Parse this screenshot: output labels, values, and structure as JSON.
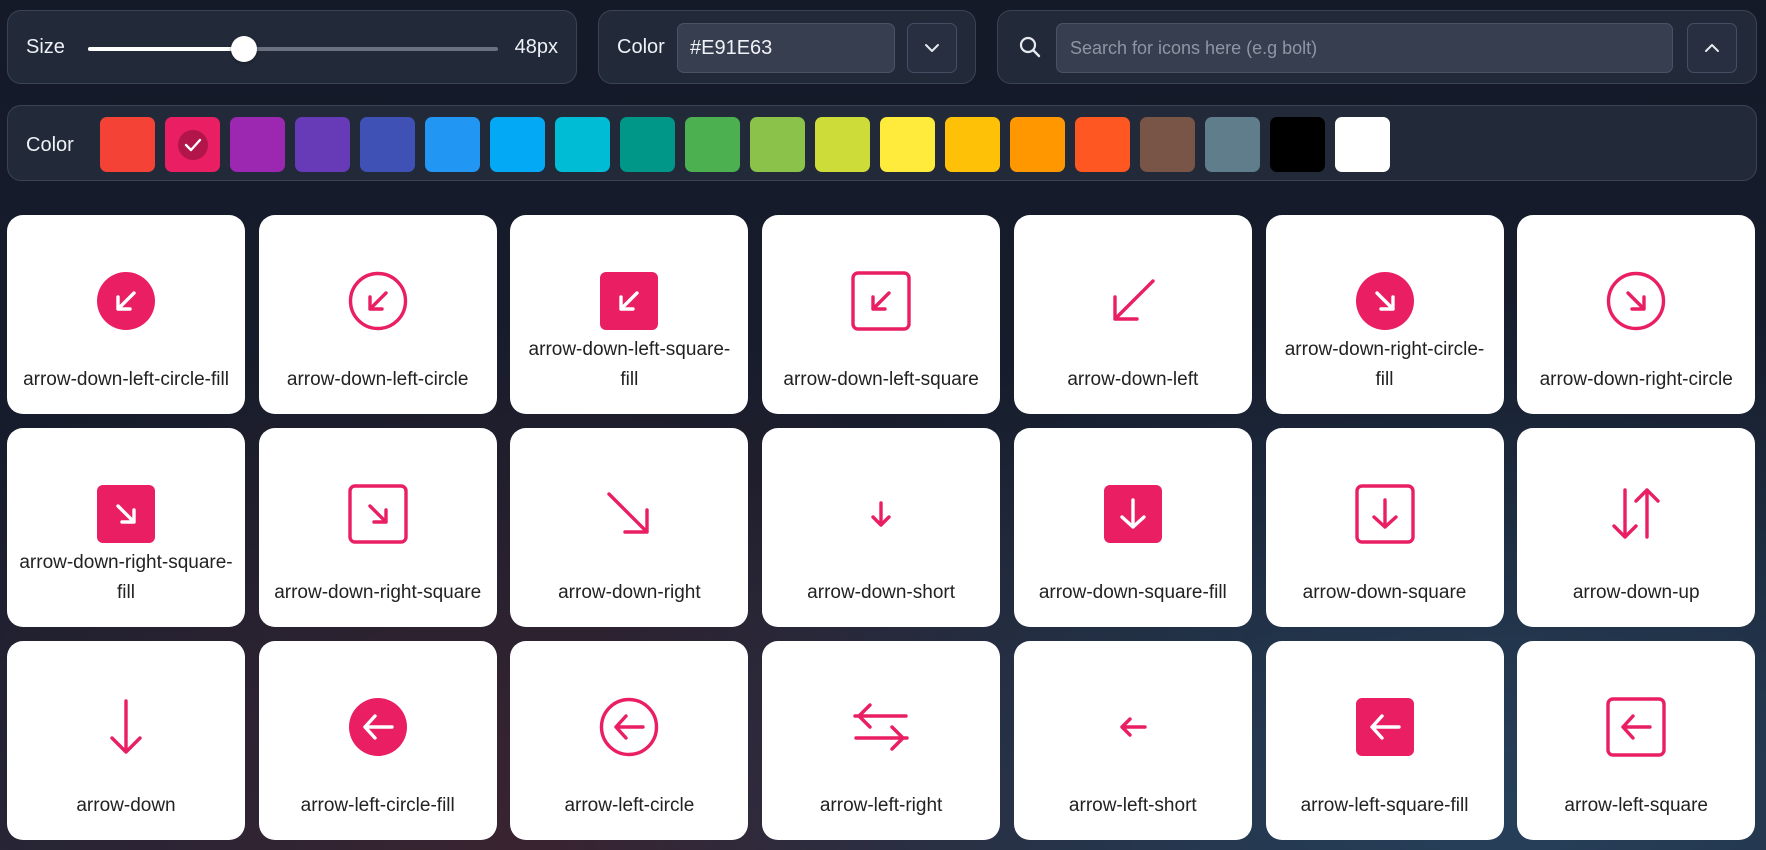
{
  "size_control": {
    "label": "Size",
    "value_text": "48px",
    "fraction": 0.38
  },
  "color_control": {
    "label": "Color",
    "value": "#E91E63",
    "dropdown_icon": "chevron-down-icon"
  },
  "search": {
    "placeholder": "Search for icons here (e.g bolt)",
    "icon": "search-icon",
    "collapse_icon": "chevron-up-icon"
  },
  "palette": {
    "label": "Color",
    "selected_index": 1,
    "swatches": [
      "#F44336",
      "#E91E63",
      "#9C27B0",
      "#673AB7",
      "#3F51B5",
      "#2196F3",
      "#03A9F4",
      "#00BCD4",
      "#009688",
      "#4CAF50",
      "#8BC34A",
      "#CDDC39",
      "#FFEB3B",
      "#FFC107",
      "#FF9800",
      "#FF5722",
      "#795548",
      "#607D8B",
      "#000000",
      "#FFFFFF"
    ]
  },
  "accent": "#E91E63",
  "icons": [
    {
      "name": "arrow-down-left-circle-fill",
      "label": [
        "arrow-down-left-circle-fill"
      ]
    },
    {
      "name": "arrow-down-left-circle",
      "label": [
        "arrow-down-left-circle"
      ]
    },
    {
      "name": "arrow-down-left-square-fill",
      "label": [
        "arrow-down-left-square-",
        "fill"
      ]
    },
    {
      "name": "arrow-down-left-square",
      "label": [
        "arrow-down-left-square"
      ]
    },
    {
      "name": "arrow-down-left",
      "label": [
        "arrow-down-left"
      ]
    },
    {
      "name": "arrow-down-right-circle-fill",
      "label": [
        "arrow-down-right-circle-",
        "fill"
      ]
    },
    {
      "name": "arrow-down-right-circle",
      "label": [
        "arrow-down-right-circle"
      ]
    },
    {
      "name": "arrow-down-right-square-fill",
      "label": [
        "arrow-down-right-square-",
        "fill"
      ]
    },
    {
      "name": "arrow-down-right-square",
      "label": [
        "arrow-down-right-square"
      ]
    },
    {
      "name": "arrow-down-right",
      "label": [
        "arrow-down-right"
      ]
    },
    {
      "name": "arrow-down-short",
      "label": [
        "arrow-down-short"
      ]
    },
    {
      "name": "arrow-down-square-fill",
      "label": [
        "arrow-down-square-fill"
      ]
    },
    {
      "name": "arrow-down-square",
      "label": [
        "arrow-down-square"
      ]
    },
    {
      "name": "arrow-down-up",
      "label": [
        "arrow-down-up"
      ]
    },
    {
      "name": "arrow-down",
      "label": [
        "arrow-down"
      ]
    },
    {
      "name": "arrow-left-circle-fill",
      "label": [
        "arrow-left-circle-fill"
      ]
    },
    {
      "name": "arrow-left-circle",
      "label": [
        "arrow-left-circle"
      ]
    },
    {
      "name": "arrow-left-right",
      "label": [
        "arrow-left-right"
      ]
    },
    {
      "name": "arrow-left-short",
      "label": [
        "arrow-left-short"
      ]
    },
    {
      "name": "arrow-left-square-fill",
      "label": [
        "arrow-left-square-fill"
      ]
    },
    {
      "name": "arrow-left-square",
      "label": [
        "arrow-left-square"
      ]
    }
  ]
}
